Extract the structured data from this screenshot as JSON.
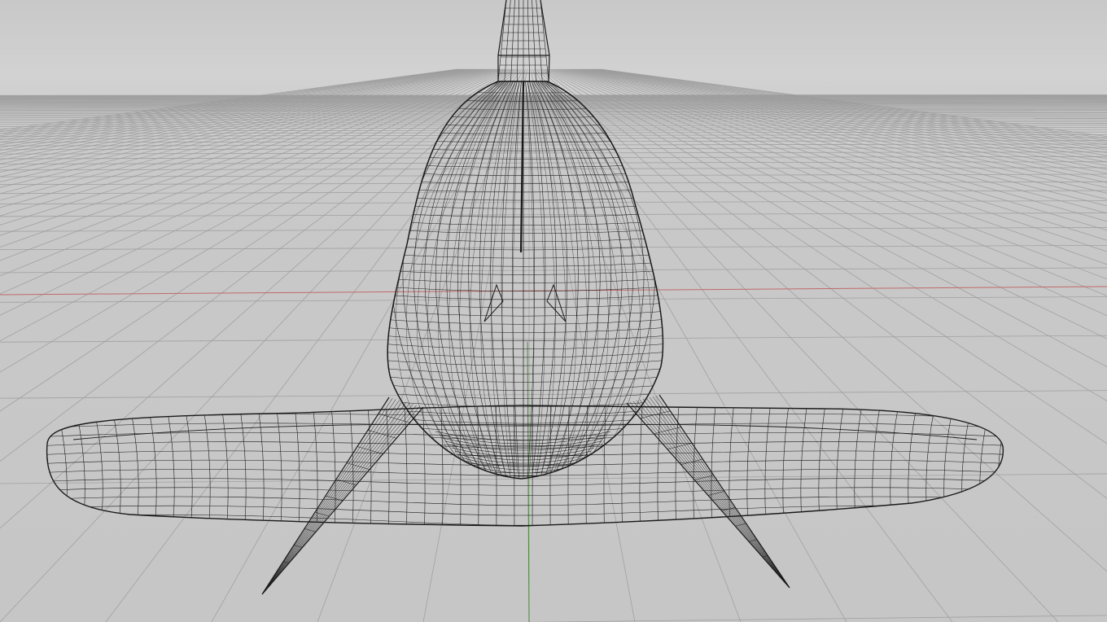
{
  "viewport": {
    "view": "perspective",
    "display_mode": "wireframe",
    "background_color": "#c7c7c7",
    "horizon_color": "#d2d2d2"
  },
  "grid": {
    "visible": true,
    "line_color": "#9a9a9a",
    "x_axis_color": "#c06a6a",
    "y_axis_color": "#4a8a3a"
  },
  "model": {
    "name": "hammerhead-shark",
    "wire_color": "#1a1a1a"
  }
}
